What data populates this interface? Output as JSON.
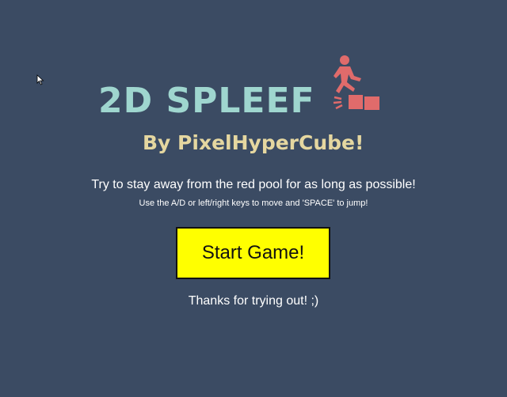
{
  "game": {
    "title": "2D SPLEEF",
    "subtitle": "By PixelHyperCube!",
    "instructions": "Try to stay away from the red pool for as long as possible!",
    "controls": "Use the A/D or left/right keys to move and 'SPACE' to jump!",
    "start_button_label": "Start Game!",
    "thanks": "Thanks for trying out! ;)"
  },
  "colors": {
    "background": "#3b4b63",
    "title": "#9fd6cf",
    "subtitle": "#e5d7a0",
    "logo_accent": "#e06b6b",
    "button_fill": "#ffff00"
  },
  "icons": {
    "logo": "running-figure-on-blocks-icon",
    "cursor": "mouse-pointer-icon"
  }
}
